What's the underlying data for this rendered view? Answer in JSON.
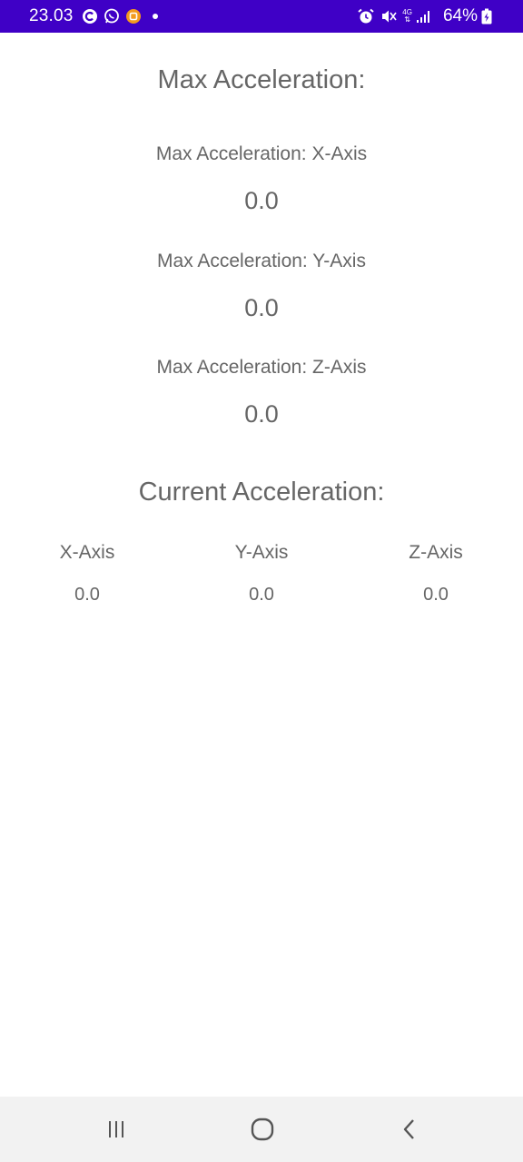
{
  "status_bar": {
    "time": "23.03",
    "network": "4G",
    "battery": "64%",
    "left_icons": [
      "c-icon",
      "whatsapp-icon",
      "app-notification-icon",
      "dot-icon"
    ],
    "right_icons": [
      "alarm-icon",
      "mute-icon",
      "network-icon",
      "signal-icon",
      "battery-icon"
    ]
  },
  "max_section": {
    "title": "Max Acceleration:",
    "x_label": "Max Acceleration: X-Axis",
    "x_value": "0.0",
    "y_label": "Max Acceleration: Y-Axis",
    "y_value": "0.0",
    "z_label": "Max Acceleration: Z-Axis",
    "z_value": "0.0"
  },
  "current_section": {
    "title": "Current Acceleration:",
    "columns": [
      {
        "label": "X-Axis",
        "value": "0.0"
      },
      {
        "label": "Y-Axis",
        "value": "0.0"
      },
      {
        "label": "Z-Axis",
        "value": "0.0"
      }
    ]
  },
  "nav_bar": {
    "buttons": [
      "recents-icon",
      "home-icon",
      "back-icon"
    ]
  },
  "colors": {
    "status_bar_bg": "#3f00c6",
    "text_gray": "#666666",
    "nav_bar_bg": "#f2f2f2"
  }
}
